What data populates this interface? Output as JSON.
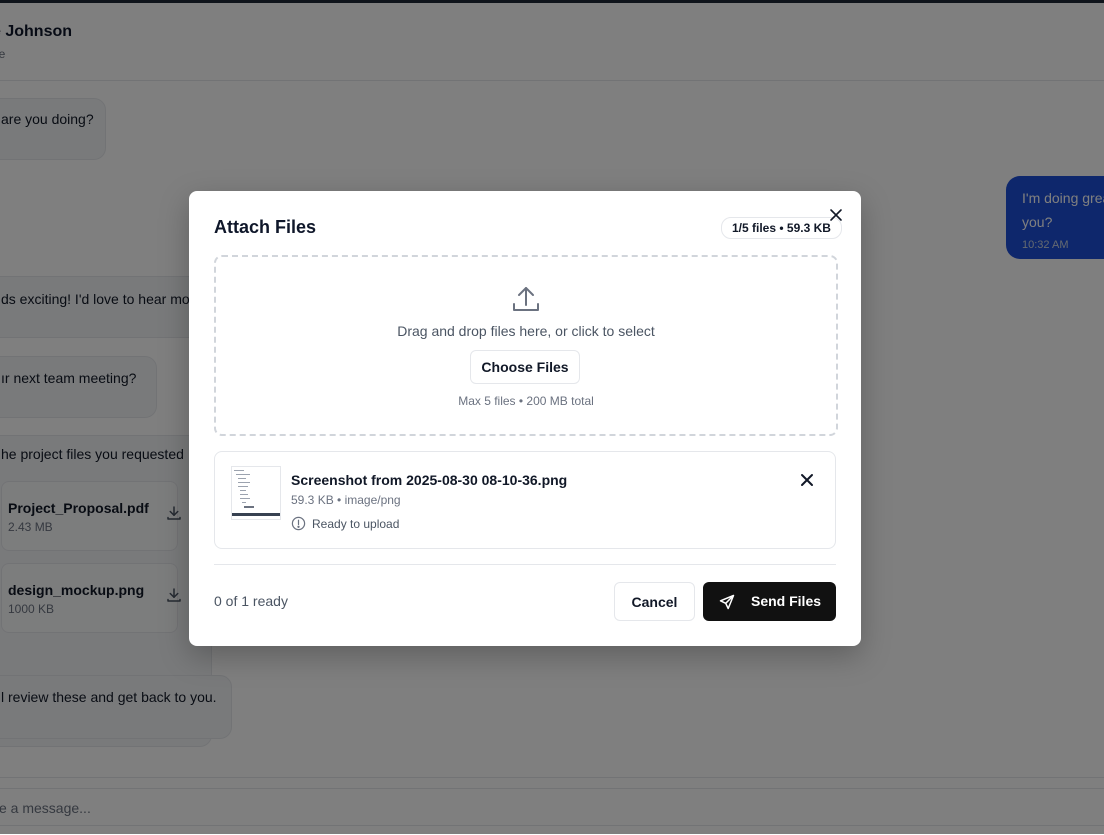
{
  "chat": {
    "contact_name": "e Johnson",
    "contact_status": "ne",
    "messages": {
      "m1": "are you doing?",
      "m_out_line1": "I'm doing great",
      "m_out_line2": "you?",
      "m_out_time": "10:32 AM",
      "m2": "ds exciting! I'd love to hear mo",
      "m3": "ır next team meeting?",
      "m4": "he project files you requested",
      "m5": "l review these and get back to you."
    },
    "attachments": [
      {
        "name": "Project_Proposal.pdf",
        "size": "2.43 MB"
      },
      {
        "name": "design_mockup.png",
        "size": "1000 KB"
      }
    ],
    "composer_placeholder": "e a message..."
  },
  "modal": {
    "title": "Attach Files",
    "count_badge": "1/5 files • 59.3 KB",
    "dropzone": {
      "instruction": "Drag and drop files here, or click to select",
      "choose_label": "Choose Files",
      "limit_text": "Max 5 files • 200 MB total"
    },
    "file": {
      "name": "Screenshot from 2025-08-30 08-10-36.png",
      "meta": "59.3 KB • image/png",
      "status": "Ready to upload"
    },
    "footer": {
      "ready_text": "0 of 1 ready",
      "cancel_label": "Cancel",
      "send_label": "Send Files"
    }
  },
  "colors": {
    "accent_dark": "#111111",
    "outgoing_bubble": "#1d4ed8"
  },
  "icons": [
    "close-icon",
    "upload-icon",
    "info-icon",
    "send-icon",
    "download-icon"
  ]
}
